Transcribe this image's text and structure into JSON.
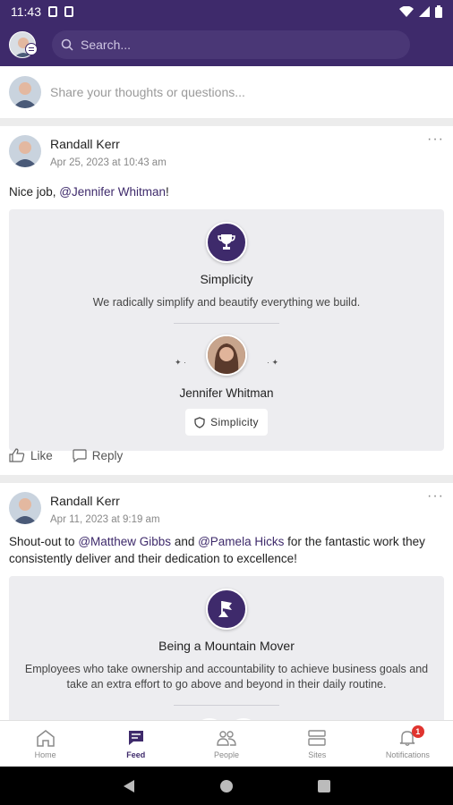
{
  "status_bar": {
    "time": "11:43"
  },
  "composer": {
    "placeholder": "Share your thoughts or questions..."
  },
  "search": {
    "placeholder": "Search..."
  },
  "posts": [
    {
      "author": "Randall Kerr",
      "date": "Apr 25, 2023 at 10:43 am",
      "text_prefix": "Nice job, ",
      "mention": "@Jennifer Whitman",
      "text_suffix": "!",
      "value_card": {
        "title": "Simplicity",
        "description": "We radically simplify and beautify everything we build.",
        "recipient": "Jennifer Whitman",
        "chip": "Simplicity"
      },
      "actions": {
        "like": "Like",
        "reply": "Reply"
      }
    },
    {
      "author": "Randall Kerr",
      "date": "Apr 11, 2023 at 9:19 am",
      "text_1": "Shout-out to ",
      "mention_1": "@Matthew Gibbs",
      "text_2": " and ",
      "mention_2": "@Pamela Hicks",
      "text_3": " for the fantastic work they consistently deliver and their dedication to excellence!",
      "value_card": {
        "title": "Being a Mountain Mover",
        "description": "Employees who take ownership and accountability to achieve business goals and take an extra effort to go above and beyond in their daily routine."
      }
    }
  ],
  "bottom_nav": [
    {
      "label": "Home",
      "icon": "home-icon"
    },
    {
      "label": "Feed",
      "icon": "feed-icon",
      "active": true
    },
    {
      "label": "People",
      "icon": "people-icon"
    },
    {
      "label": "Sites",
      "icon": "sites-icon"
    },
    {
      "label": "Notifications",
      "icon": "bell-icon",
      "count": "1"
    }
  ],
  "colors": {
    "brand": "#3e2a6b",
    "notification": "#e0342f"
  }
}
